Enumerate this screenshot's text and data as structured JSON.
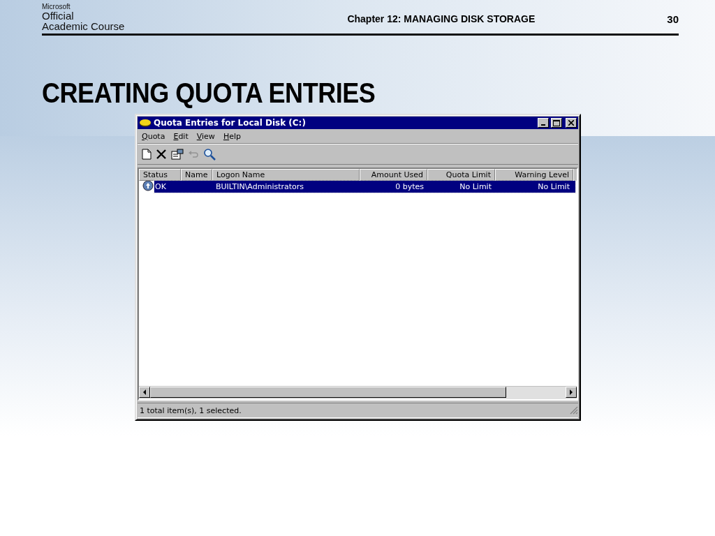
{
  "slide_header": {
    "logo_lines": [
      "Microsoft",
      "Official",
      "Academic Course"
    ],
    "chapter": "Chapter 12: MANAGING DISK STORAGE",
    "page_number": "30"
  },
  "slide_title": "CREATING QUOTA ENTRIES",
  "window": {
    "title": "Quota Entries for Local Disk (C:)",
    "menu": [
      "Quota",
      "Edit",
      "View",
      "Help"
    ],
    "toolbar": [
      {
        "kind": "new",
        "disabled": false
      },
      {
        "kind": "delete",
        "disabled": false
      },
      {
        "kind": "properties",
        "disabled": false
      },
      {
        "kind": "undo",
        "disabled": true
      },
      {
        "kind": "find",
        "disabled": false
      }
    ],
    "table": {
      "columns": [
        "Status",
        "Name",
        "Logon Name",
        "Amount Used",
        "Quota Limit",
        "Warning Level"
      ],
      "rows": [
        {
          "cells": [
            "OK",
            "",
            "BUILTIN\\Administrators",
            "0 bytes",
            "No Limit",
            "No Limit"
          ],
          "selected": true
        }
      ]
    },
    "status_bar": "1 total item(s), 1 selected."
  }
}
